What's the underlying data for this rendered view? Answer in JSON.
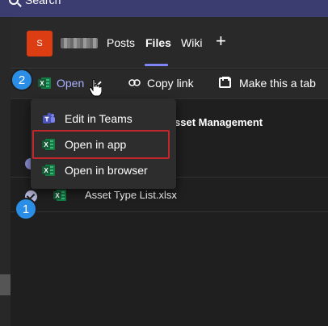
{
  "search": {
    "label": "Search",
    "icon": "search-icon"
  },
  "team": {
    "avatar_initial": "S"
  },
  "tabs": [
    {
      "label": "Posts"
    },
    {
      "label": "Files"
    },
    {
      "label": "Wiki"
    }
  ],
  "active_tab": "Files",
  "add_tab_symbol": "+",
  "toolbar": {
    "open_label": "Open",
    "copy_link_label": "Copy link",
    "make_tab_label": "Make this a tab"
  },
  "open_menu": {
    "items": [
      {
        "label": "Edit in Teams",
        "icon": "teams-icon"
      },
      {
        "label": "Open in app",
        "icon": "excel-icon",
        "highlighted": true
      },
      {
        "label": "Open in browser",
        "icon": "excel-icon"
      }
    ]
  },
  "list": {
    "partial_header": "sset Management",
    "files": [
      {
        "name": "Asset Type List.xlsx",
        "selected": true
      }
    ]
  },
  "badges": {
    "step_one": "1",
    "step_two": "2"
  },
  "colors": {
    "accent": "#7f85f5",
    "badge": "#2b8ee6",
    "highlight_border": "#c4262e",
    "excel_green": "#107c41",
    "team_avatar": "#dc3d13"
  }
}
